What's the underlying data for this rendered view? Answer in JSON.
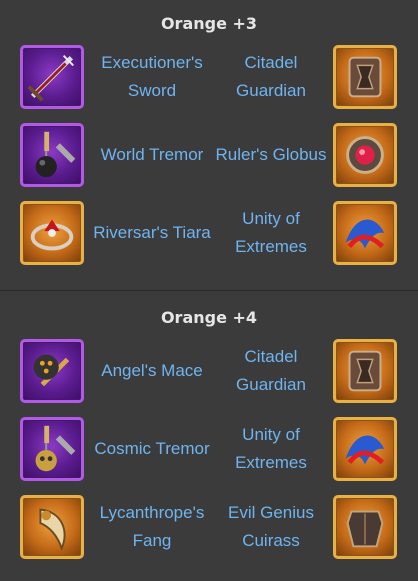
{
  "sections": [
    {
      "title": "Orange +3",
      "rows": [
        {
          "left_item": "Executioner's Sword",
          "right_item": "Citadel Guardian",
          "left_icon": "sword-icon",
          "right_icon": "armor-plate-icon"
        },
        {
          "left_item": "World Tremor",
          "right_item": "Ruler's Globus",
          "left_icon": "flail-icon",
          "right_icon": "orb-icon"
        },
        {
          "left_item": "Riversar's Tiara",
          "right_item": "Unity of Extremes",
          "left_icon": "tiara-icon",
          "right_icon": "dragon-icon"
        }
      ]
    },
    {
      "title": "Orange +4",
      "rows": [
        {
          "left_item": "Angel's Mace",
          "right_item": "Citadel Guardian",
          "left_icon": "mace-icon",
          "right_icon": "armor-plate-icon"
        },
        {
          "left_item": "Cosmic Tremor",
          "right_item": "Unity of Extremes",
          "left_icon": "skull-flail-icon",
          "right_icon": "dragon-icon"
        },
        {
          "left_item": "Lycanthrope's Fang",
          "right_item": "Evil Genius Cuirass",
          "left_icon": "fang-icon",
          "right_icon": "cuirass-icon"
        }
      ]
    }
  ],
  "colors": {
    "background": "#3b3b3b",
    "title": "#e6e6e6",
    "item_text": "#6fb4f0",
    "purple_frame": "#b15ae6",
    "gold_frame": "#e9b046"
  }
}
